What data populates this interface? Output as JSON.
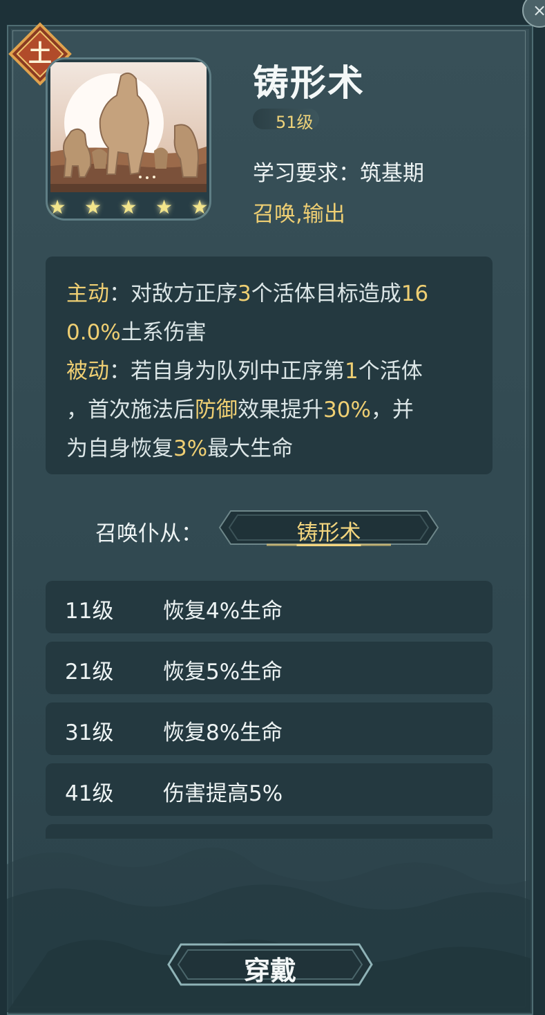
{
  "skill": {
    "element": "土",
    "name": "铸形术",
    "level": "51级",
    "stars": 5,
    "requirement": "学习要求：筑基期",
    "tags": "召唤,输出"
  },
  "description": {
    "line1_prefix": "主动",
    "line1_a": "：对敌方正序",
    "line1_num": "3",
    "line1_b": "个活体目标造成",
    "line1_pct": "16",
    "line2_pct": "0.0%",
    "line2_b": "土系伤害",
    "line3_prefix": "被动",
    "line3_a": "：若自身为队列中正序第",
    "line3_num": "1",
    "line3_b": "个活体",
    "line4_a": "，首次施法后",
    "line4_gold": "防御",
    "line4_b": "效果提升",
    "line4_pct": "30%",
    "line4_c": "，并",
    "line5_a": "为自身恢复",
    "line5_pct": "3%",
    "line5_b": "最大生命"
  },
  "summon": {
    "label": "召唤仆从：",
    "button": "铸形术"
  },
  "upgrades": [
    {
      "level": "11级",
      "effect": "恢复4%生命"
    },
    {
      "level": "21级",
      "effect": "恢复5%生命"
    },
    {
      "level": "31级",
      "effect": "恢复8%生命"
    },
    {
      "level": "41级",
      "effect": "伤害提高5%"
    }
  ],
  "actions": {
    "wear": "穿戴",
    "close_icon": "close-icon"
  }
}
